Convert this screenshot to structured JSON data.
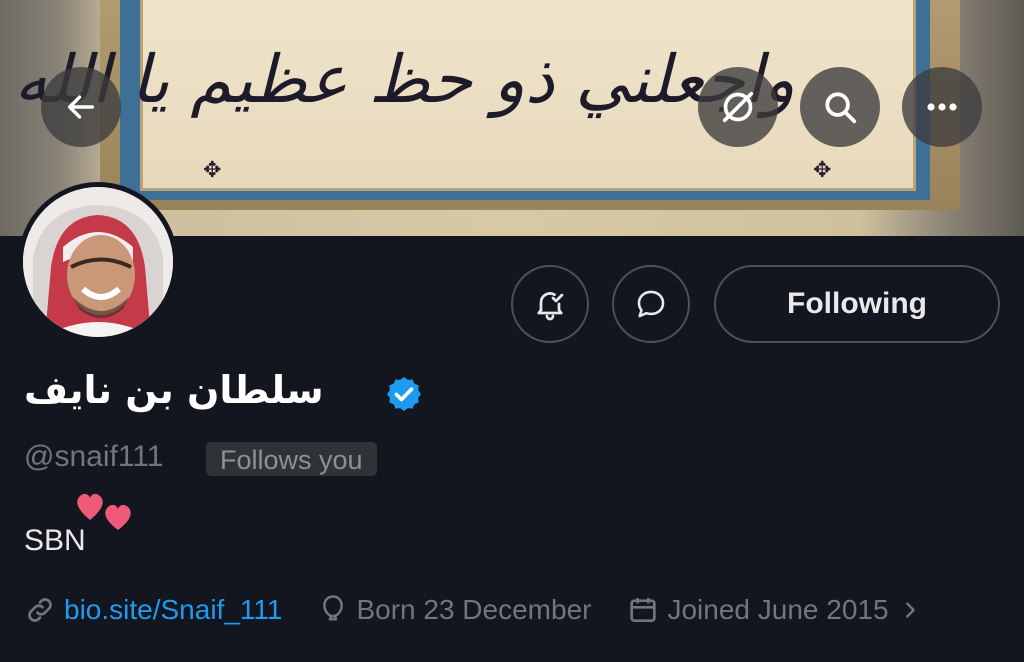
{
  "banner": {
    "calligraphy_text": "واجعلني ذو حظ عظيم يا الله",
    "ornament_symbol": "✥"
  },
  "top_buttons": {
    "back_icon": "arrow-left-icon",
    "grok_icon": "grok-icon",
    "search_icon": "search-icon",
    "more_icon": "more-dots-icon"
  },
  "actions": {
    "notify_icon": "bell-check-icon",
    "message_icon": "message-bubble-icon",
    "following_label": "Following"
  },
  "profile": {
    "display_name": "سلطان بن نايف",
    "verified_color": "#1d9bf0",
    "handle": "@snaif111",
    "follows_you": "Follows you",
    "bio": "SBN",
    "bio_emoji": "❤️❤️"
  },
  "meta": {
    "website": "bio.site/Snaif_111",
    "birthday": "Born 23 December",
    "joined": "Joined June 2015"
  },
  "colors": {
    "background": "#14161f",
    "accent": "#1d9bf0",
    "secondary_text": "#71767b",
    "heart": "#f05a7a"
  }
}
